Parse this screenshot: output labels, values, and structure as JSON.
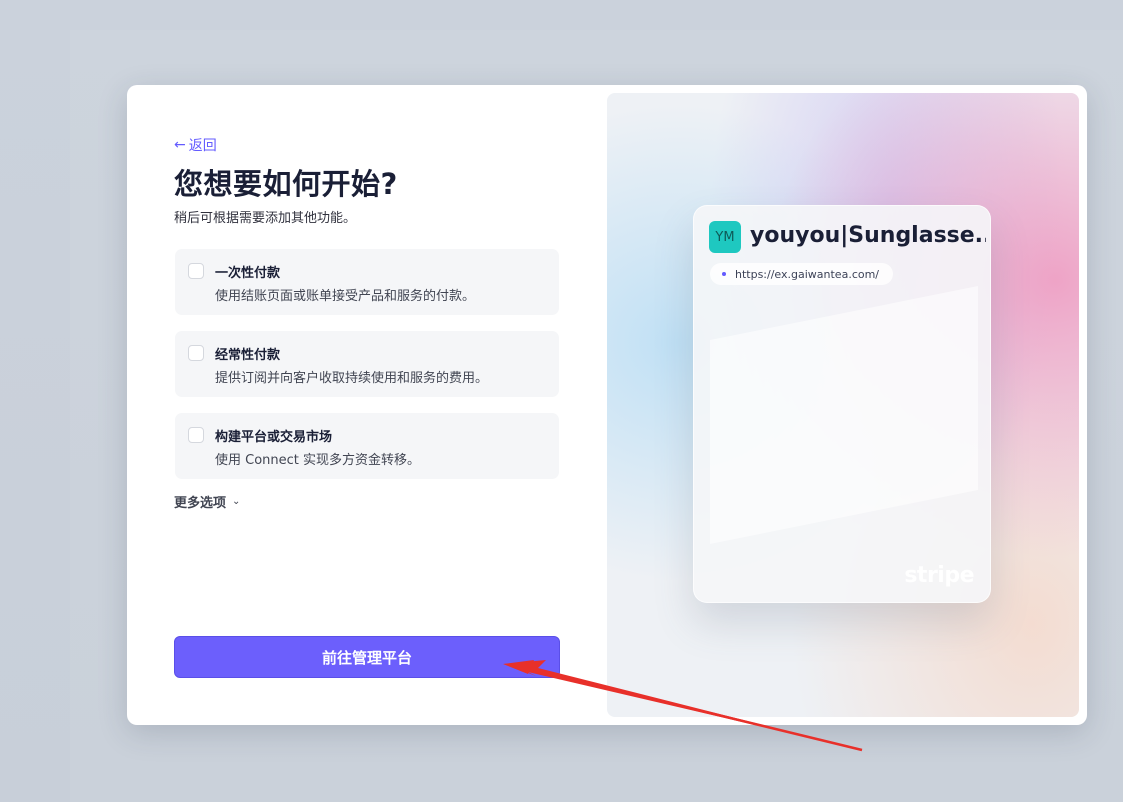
{
  "back": {
    "label": "返回",
    "icon": "arrow-left-icon"
  },
  "heading": {
    "title": "您想要如何开始?",
    "subtitle": "稍后可根据需要添加其他功能。"
  },
  "options": [
    {
      "title": "一次性付款",
      "description": "使用结账页面或账单接受产品和服务的付款。",
      "checked": false
    },
    {
      "title": "经常性付款",
      "description": "提供订阅并向客户收取持续使用和服务的费用。",
      "checked": false
    },
    {
      "title": "构建平台或交易市场",
      "description": "使用 Connect 实现多方资金转移。",
      "checked": false
    }
  ],
  "more_options": {
    "label": "更多选项",
    "icon": "chevron-down-icon"
  },
  "primary_button": {
    "label": "前往管理平台"
  },
  "preview": {
    "avatar_initials": "YM",
    "business_name": "youyou|Sunglasse...",
    "url": "https://ex.gaiwantea.com/",
    "brand": "stripe"
  },
  "colors": {
    "accent": "#635bff",
    "button": "#6c5ffc",
    "avatar": "#1ec8c0",
    "annotation_arrow": "#e8302a"
  }
}
